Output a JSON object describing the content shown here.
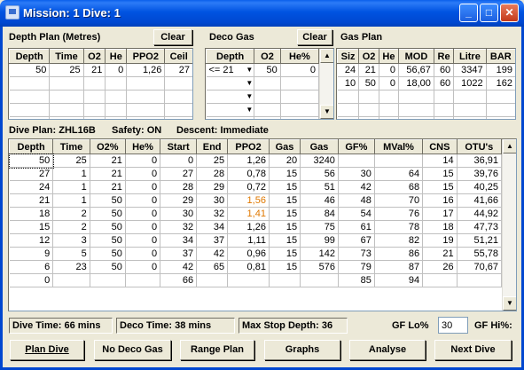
{
  "window": {
    "title": "Mission: 1 Dive: 1",
    "min": "_",
    "max": "□",
    "close": "✕"
  },
  "depth_plan": {
    "label": "Depth Plan (Metres)",
    "clear": "Clear",
    "headers": [
      "Depth",
      "Time",
      "O2",
      "He",
      "PPO2",
      "Ceil"
    ],
    "rows": [
      [
        "50",
        "25",
        "21",
        "0",
        "1,26",
        "27"
      ],
      [
        "",
        "",
        "",
        "",
        "",
        ""
      ],
      [
        "",
        "",
        "",
        "",
        "",
        ""
      ],
      [
        "",
        "",
        "",
        "",
        "",
        ""
      ],
      [
        "",
        "",
        "",
        "",
        "",
        ""
      ]
    ]
  },
  "deco_gas": {
    "label": "Deco Gas",
    "clear": "Clear",
    "headers": [
      "Depth",
      "O2",
      "He%"
    ],
    "rows": [
      [
        "<= 21",
        "50",
        "0"
      ],
      [
        "",
        "",
        ""
      ],
      [
        "",
        "",
        ""
      ],
      [
        "",
        "",
        ""
      ],
      [
        "",
        "",
        ""
      ]
    ]
  },
  "gas_plan": {
    "label": "Gas Plan",
    "headers": [
      "Siz",
      "O2",
      "He",
      "MOD",
      "Re",
      "Litre",
      "BAR"
    ],
    "rows": [
      [
        "24",
        "21",
        "0",
        "56,67",
        "60",
        "3347",
        "199"
      ],
      [
        "10",
        "50",
        "0",
        "18,00",
        "60",
        "1022",
        "162"
      ],
      [
        "",
        "",
        "",
        "",
        "",
        "",
        ""
      ],
      [
        "",
        "",
        "",
        "",
        "",
        "",
        ""
      ],
      [
        "",
        "",
        "",
        "",
        "",
        "",
        ""
      ]
    ]
  },
  "info": {
    "dive_plan": "Dive Plan: ZHL16B",
    "safety": "Safety: ON",
    "descent": "Descent: Immediate"
  },
  "dive_table": {
    "headers": [
      "Depth",
      "Time",
      "O2%",
      "He%",
      "Start",
      "End",
      "PPO2",
      "Gas",
      "Gas",
      "GF%",
      "MVal%",
      "CNS",
      "OTU's"
    ],
    "rows": [
      [
        "50",
        "25",
        "21",
        "0",
        "0",
        "25",
        "1,26",
        "20",
        "3240",
        "",
        "",
        "14",
        "36,91"
      ],
      [
        "27",
        "1",
        "21",
        "0",
        "27",
        "28",
        "0,78",
        "15",
        "56",
        "30",
        "64",
        "15",
        "39,76"
      ],
      [
        "24",
        "1",
        "21",
        "0",
        "28",
        "29",
        "0,72",
        "15",
        "51",
        "42",
        "68",
        "15",
        "40,25"
      ],
      [
        "21",
        "1",
        "50",
        "0",
        "29",
        "30",
        "1,56",
        "15",
        "46",
        "48",
        "70",
        "16",
        "41,66"
      ],
      [
        "18",
        "2",
        "50",
        "0",
        "30",
        "32",
        "1,41",
        "15",
        "84",
        "54",
        "76",
        "17",
        "44,92"
      ],
      [
        "15",
        "2",
        "50",
        "0",
        "32",
        "34",
        "1,26",
        "15",
        "75",
        "61",
        "78",
        "18",
        "47,73"
      ],
      [
        "12",
        "3",
        "50",
        "0",
        "34",
        "37",
        "1,11",
        "15",
        "99",
        "67",
        "82",
        "19",
        "51,21"
      ],
      [
        "9",
        "5",
        "50",
        "0",
        "37",
        "42",
        "0,96",
        "15",
        "142",
        "73",
        "86",
        "21",
        "55,78"
      ],
      [
        "6",
        "23",
        "50",
        "0",
        "42",
        "65",
        "0,81",
        "15",
        "576",
        "79",
        "87",
        "26",
        "70,67"
      ],
      [
        "0",
        "",
        "",
        "",
        "66",
        "",
        "",
        "",
        "",
        "85",
        "94",
        "",
        ""
      ]
    ],
    "highlight_color": "#E07800"
  },
  "status": {
    "dive_time": "Dive Time: 66 mins",
    "deco_time": "Deco Time: 38 mins",
    "max_stop": "Max Stop Depth: 36",
    "gf_lo_label": "GF Lo%",
    "gf_lo_value": "30",
    "gf_hi_label": "GF Hi%:"
  },
  "buttons": {
    "plan_dive": "Plan Dive",
    "no_deco": "No Deco Gas",
    "range_plan": "Range Plan",
    "graphs": "Graphs",
    "analyse": "Analyse",
    "next_dive": "Next Dive"
  }
}
